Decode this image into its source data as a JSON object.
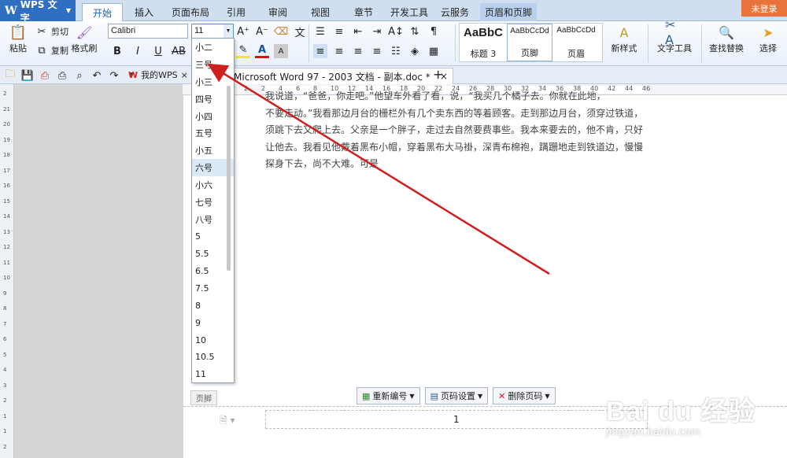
{
  "app": {
    "name": "WPS 文字",
    "login": "未登录"
  },
  "tabs": [
    "开始",
    "插入",
    "页面布局",
    "引用",
    "审阅",
    "视图",
    "章节",
    "开发工具",
    "云服务",
    "页眉和页脚"
  ],
  "ribbon": {
    "paste": "粘贴",
    "cut": "剪切",
    "copy": "复制",
    "format_painter": "格式刷",
    "font_name": "Calibri",
    "font_size": "11",
    "styles": [
      {
        "preview": "AaBbC",
        "name": "标题 3"
      },
      {
        "preview": "AaBbCcDd",
        "name": "页脚"
      },
      {
        "preview": "AaBbCcDd",
        "name": "页眉"
      }
    ],
    "new_style": "新样式",
    "text_tool": "文字工具",
    "find_replace": "查找替换",
    "select": "选择"
  },
  "quickbar": {
    "mywps": "我的WPS",
    "doc_tab": "Microsoft Word 97 - 2003 文档 - 副本.doc *"
  },
  "ruler_top": [
    "2",
    "2",
    "4",
    "6",
    "8",
    "10",
    "12",
    "14",
    "16",
    "18",
    "20",
    "22",
    "24",
    "26",
    "28",
    "30",
    "32",
    "34",
    "36",
    "38",
    "40",
    "42",
    "44",
    "46"
  ],
  "ruler_left": [
    "2",
    "21",
    "20",
    "19",
    "18",
    "17",
    "16",
    "15",
    "14",
    "13",
    "12",
    "11",
    "10",
    "9",
    "8",
    "7",
    "6",
    "5",
    "4",
    "3",
    "2",
    "1",
    "1",
    "2"
  ],
  "body_lines": [
    "我说道，“爸爸，你走吧。”他望车外看了看，说，“我买几个橘子去。你就在此地，",
    "不要走动。”我看那边月台的栅栏外有几个卖东西的等着顾客。走到那边月台，须穿过铁道，",
    "须跳下去又爬上去。父亲是一个胖子，走过去自然要费事些。我本来要去的，他不肯，只好",
    "让他去。我看见他戴着黑布小帽，穿着黑布大马褂，深青布棉袍，蹒跚地走到铁道边，慢慢",
    "探身下去，尚不大难。可是"
  ],
  "footer": {
    "label": "页脚",
    "renumber": "重新编号",
    "page_setup": "页码设置",
    "delete_page_num": "删除页码",
    "page_number": "1"
  },
  "font_size_options": [
    "小二",
    "三号",
    "小三",
    "四号",
    "小四",
    "五号",
    "小五",
    "六号",
    "小六",
    "七号",
    "八号",
    "5",
    "5.5",
    "6.5",
    "7.5",
    "8",
    "9",
    "10",
    "10.5",
    "11"
  ],
  "font_size_selected": "六号",
  "watermark": {
    "main": "Bai du 经验",
    "url": "jingyan.baidu.com"
  },
  "colors": {
    "accent": "#2f6fc2",
    "arrow": "#d01f1f",
    "login": "#e8743b"
  }
}
